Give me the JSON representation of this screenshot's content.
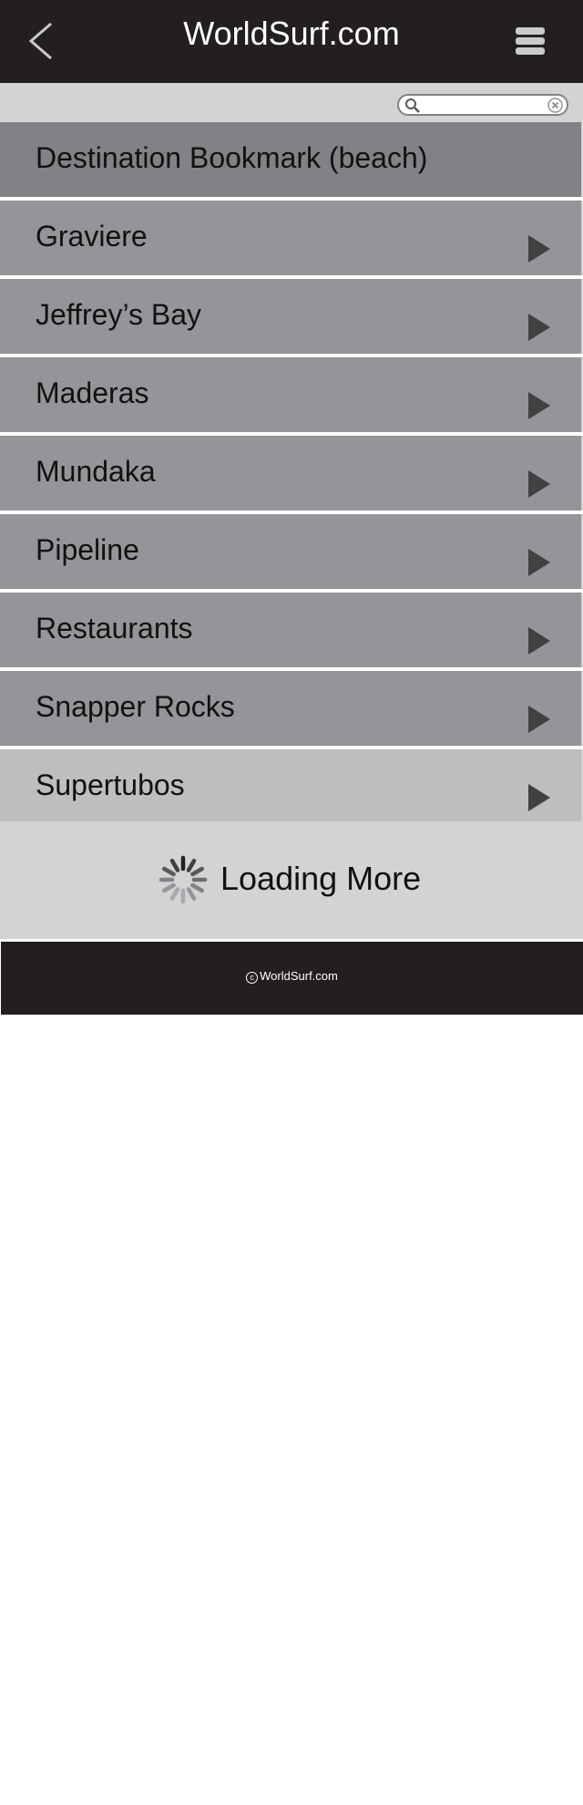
{
  "header": {
    "title": "WorldSurf.com",
    "back_icon": "chevron-left-icon",
    "menu_icon": "menu-icon"
  },
  "search": {
    "value": "",
    "placeholder": "",
    "search_icon": "search-icon",
    "clear_icon": "clear-icon"
  },
  "list": {
    "header": "Destination Bookmark (beach)",
    "items": [
      {
        "label": "Graviere"
      },
      {
        "label": "Jeffrey’s Bay"
      },
      {
        "label": "Maderas"
      },
      {
        "label": "Mundaka"
      },
      {
        "label": "Pipeline"
      },
      {
        "label": "Restaurants"
      },
      {
        "label": "Snapper Rocks"
      },
      {
        "label": "Supertubos"
      }
    ]
  },
  "loading": {
    "label": "Loading More",
    "icon": "spinner-icon"
  },
  "footer": {
    "copyright_symbol": "c",
    "copyright_text": "WorldSurf.com"
  },
  "colors": {
    "header_bg": "#231f20",
    "list_header_bg": "#808285",
    "list_item_bg": "#939598",
    "list_item_last_bg": "#bcbec0",
    "panel_bg": "#d1d3d4",
    "arrow": "#414042"
  }
}
